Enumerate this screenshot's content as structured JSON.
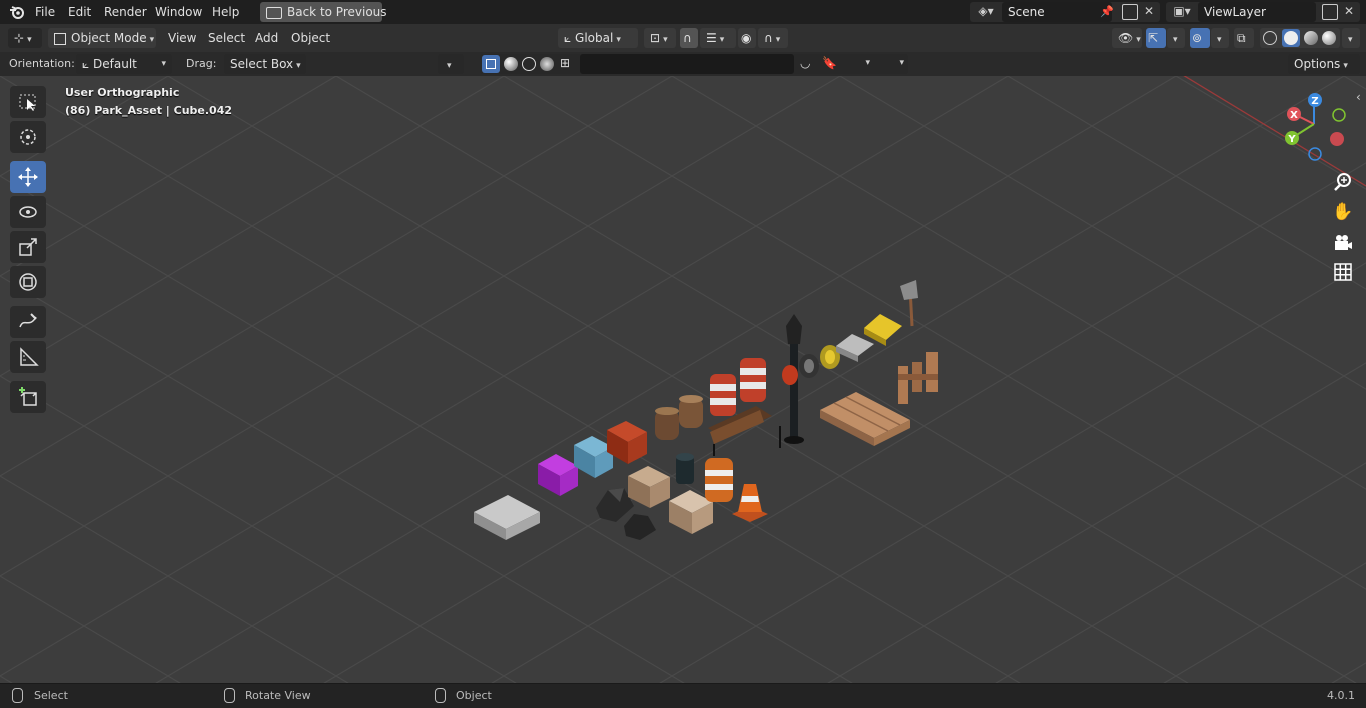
{
  "topbar": {
    "menus": [
      "File",
      "Edit",
      "Render",
      "Window",
      "Help"
    ],
    "back_button": "Back to Previous",
    "scene": "Scene",
    "view_layer": "ViewLayer"
  },
  "header": {
    "mode": "Object Mode",
    "menus": [
      "View",
      "Select",
      "Add",
      "Object"
    ],
    "transform_orientation": "Global"
  },
  "tool_header": {
    "orientation_label": "Orientation:",
    "orientation_value": "Default",
    "drag_label": "Drag:",
    "drag_value": "Select Box",
    "search_placeholder": "",
    "options": "Options"
  },
  "viewport": {
    "view_name": "User Orthographic",
    "object_info": "(86) Park_Asset | Cube.042",
    "gizmo": {
      "x": "X",
      "y": "Y",
      "z": "Z"
    }
  },
  "toolbar": {
    "tools": [
      "select-box",
      "cursor",
      "move",
      "rotate",
      "scale",
      "transform",
      "annotate",
      "measure",
      "add-cube"
    ],
    "active": "move"
  },
  "statusbar": {
    "select": "Select",
    "rotate_view": "Rotate View",
    "object": "Object",
    "version": "4.0.1"
  },
  "colors": {
    "accent": "#4772b3",
    "viewport_bg": "#3d3d3d",
    "x_axis": "#e0535a",
    "y_axis": "#80c430",
    "z_axis": "#3b8ae0"
  }
}
